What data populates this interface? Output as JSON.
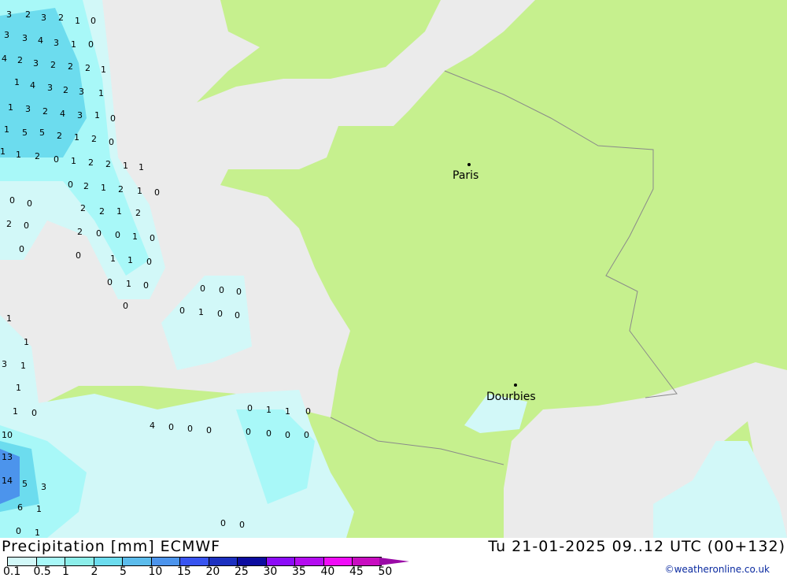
{
  "map": {
    "colors": {
      "land": "#c6f08e",
      "sea": "#ebebeb",
      "border": "#8a8a8a"
    },
    "cities": [
      {
        "name": "Paris"
      },
      {
        "name": "Dourbies"
      }
    ],
    "precip_values": [
      "3",
      "2",
      "3",
      "2",
      "1",
      "0",
      "3",
      "3",
      "4",
      "3",
      "1",
      "0",
      "4",
      "2",
      "3",
      "2",
      "2",
      "2",
      "1",
      "1",
      "4",
      "3",
      "2",
      "3",
      "1",
      "1",
      "3",
      "2",
      "4",
      "3",
      "1",
      "0",
      "1",
      "5",
      "5",
      "2",
      "1",
      "2",
      "0",
      "1",
      "1",
      "2",
      "0",
      "1",
      "2",
      "2",
      "1",
      "1",
      "0",
      "2",
      "1",
      "2",
      "1",
      "0",
      "2",
      "2",
      "1",
      "2",
      "0",
      "0",
      "2",
      "0",
      "2",
      "0",
      "0",
      "1",
      "0",
      "0",
      "0",
      "1",
      "1",
      "0",
      "0",
      "1",
      "0",
      "0",
      "0",
      "0",
      "0",
      "0",
      "1",
      "0",
      "0",
      "10",
      "13",
      "14",
      "5",
      "3",
      "6",
      "1",
      "0",
      "1",
      "1",
      "1",
      "3",
      "1",
      "1",
      "1",
      "0",
      "0",
      "1",
      "1",
      "0",
      "4",
      "0",
      "0",
      "0",
      "0",
      "0",
      "0",
      "0",
      "0",
      "0"
    ]
  },
  "footer": {
    "title": "Precipitation [mm] ECMWF",
    "datetime": "Tu 21-01-2025 09..12 UTC (00+132)",
    "credit": "©weatheronline.co.uk",
    "legend": {
      "labels": [
        "0.1",
        "0.5",
        "1",
        "2",
        "5",
        "10",
        "15",
        "20",
        "25",
        "30",
        "35",
        "40",
        "45",
        "50"
      ],
      "colors": [
        "#d2f8f8",
        "#a8f8f8",
        "#8ceeea",
        "#6cdcee",
        "#5cbcec",
        "#4c94ec",
        "#3854f0",
        "#1c30c0",
        "#0c0ca0",
        "#8c0cf8",
        "#b40cf0",
        "#f00cf8",
        "#c80cc0",
        "#9a0aa6"
      ]
    }
  }
}
